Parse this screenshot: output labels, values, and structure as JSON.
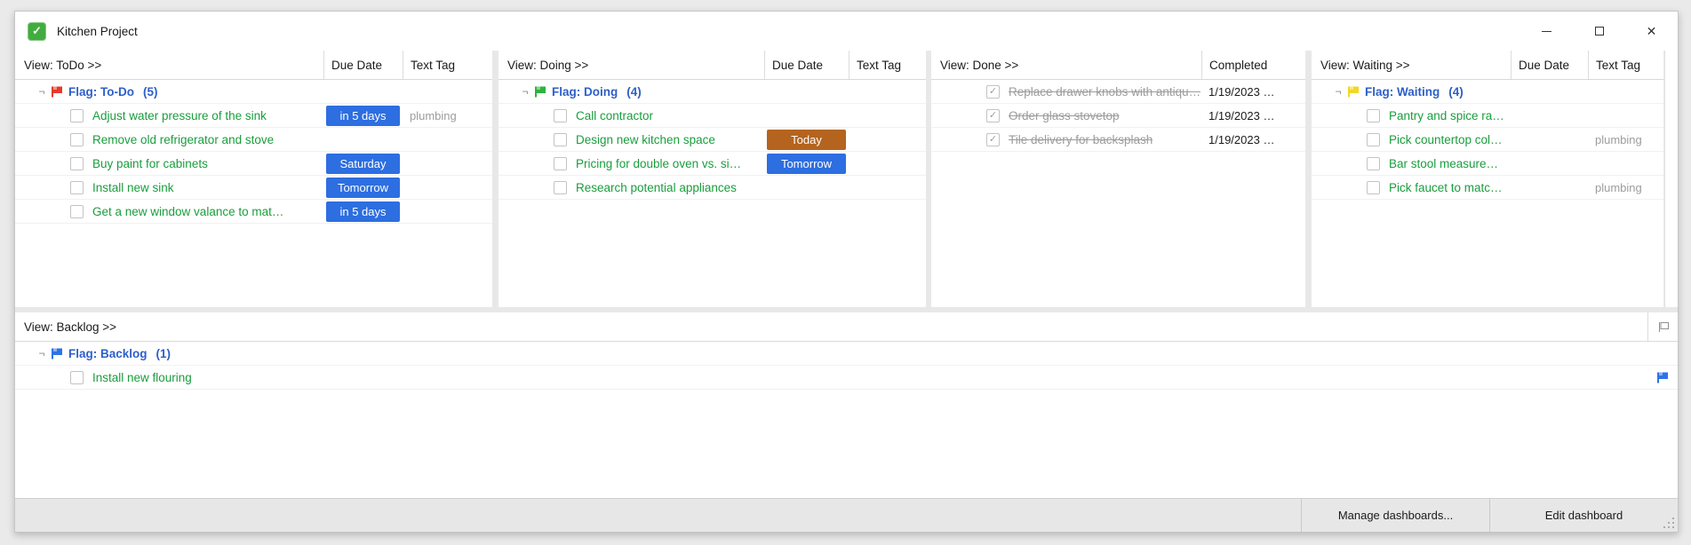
{
  "window": {
    "title": "Kitchen Project"
  },
  "colors": {
    "badge_blue": "#2d6ee1",
    "badge_orange": "#b4641e",
    "task_green": "#199e3c",
    "group_blue": "#2d5fc8",
    "muted_gray": "#9c9c9c",
    "flag_red": "#e5392c",
    "flag_green": "#2eb33c",
    "flag_yellow": "#f4d626",
    "flag_blue": "#2e72e8"
  },
  "panels": [
    {
      "id": "todo",
      "title": "View: ToDo >>",
      "columns": [
        "Due Date",
        "Text Tag"
      ],
      "group": {
        "label": "Flag: To-Do",
        "count": "(5)",
        "flag_color": "#e5392c"
      },
      "tasks": [
        {
          "label": "Adjust water pressure of the sink",
          "due": "in 5 days",
          "due_style": "blue",
          "tag": "plumbing"
        },
        {
          "label": "Remove old refrigerator and stove"
        },
        {
          "label": "Buy paint for cabinets",
          "due": "Saturday",
          "due_style": "blue"
        },
        {
          "label": "Install new sink",
          "due": "Tomorrow",
          "due_style": "blue"
        },
        {
          "label": "Get a new window valance to mat…",
          "due": "in 5 days",
          "due_style": "blue"
        }
      ]
    },
    {
      "id": "doing",
      "title": "View: Doing >>",
      "columns": [
        "Due Date",
        "Text Tag"
      ],
      "group": {
        "label": "Flag: Doing",
        "count": "(4)",
        "flag_color": "#2eb33c"
      },
      "tasks": [
        {
          "label": "Call contractor"
        },
        {
          "label": "Design new kitchen space",
          "due": "Today",
          "due_style": "orange"
        },
        {
          "label": "Pricing for double oven vs. si…",
          "due": "Tomorrow",
          "due_style": "blue"
        },
        {
          "label": "Research potential appliances"
        }
      ]
    },
    {
      "id": "done",
      "title": "View: Done >>",
      "columns": [
        "Completed"
      ],
      "tasks": [
        {
          "label": "Replace drawer knobs with antiqu…",
          "completed": "1/19/2023 …",
          "done": true
        },
        {
          "label": "Order glass stovetop",
          "completed": "1/19/2023 …",
          "done": true
        },
        {
          "label": "Tile delivery for backsplash",
          "completed": "1/19/2023 …",
          "done": true
        }
      ]
    },
    {
      "id": "waiting",
      "title": "View: Waiting >>",
      "columns": [
        "Due Date",
        "Text Tag"
      ],
      "group": {
        "label": "Flag: Waiting",
        "count": "(4)",
        "flag_color": "#f4d626"
      },
      "tasks": [
        {
          "label": "Pantry and spice ra…"
        },
        {
          "label": "Pick countertop col…",
          "tag": "plumbing"
        },
        {
          "label": "Bar stool measure…"
        },
        {
          "label": "Pick faucet to matc…",
          "tag": "plumbing"
        }
      ]
    }
  ],
  "backlog": {
    "id": "backlog",
    "title": "View: Backlog >>",
    "group": {
      "label": "Flag: Backlog",
      "count": "(1)",
      "flag_color": "#2e72e8"
    },
    "tasks": [
      {
        "label": "Install new flouring",
        "flag_color": "#2e72e8"
      }
    ]
  },
  "statusbar": {
    "manage_label": "Manage dashboards...",
    "edit_label": "Edit dashboard"
  }
}
